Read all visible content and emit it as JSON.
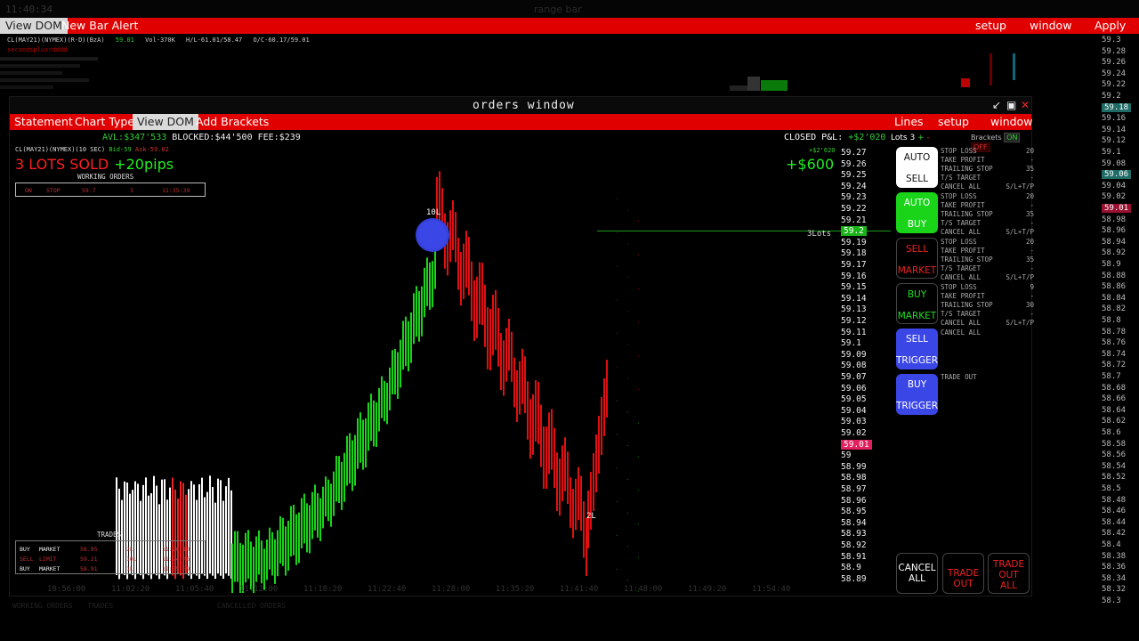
{
  "os_title": "range bar",
  "os_clock": "11:40:34",
  "topbar": {
    "view_dom": "View DOM",
    "new_bar_alert": "New Bar Alert",
    "setup": "setup",
    "window": "window",
    "apply": "Apply"
  },
  "bg_info": {
    "symbol": "CL(MAY21)(NYMEX)(R-D)(BzA)",
    "last": "59.01",
    "vol": "Vol-370K",
    "hl": "H/L-61.01/58.47",
    "oc": "O/C-60.17/59.01",
    "note": "secondsplusrdddd"
  },
  "far_ladder": [
    "59.3",
    "59.28",
    "59.26",
    "59.24",
    "59.22",
    "59.2",
    "59.18",
    "59.16",
    "59.14",
    "59.12",
    "59.1",
    "59.08",
    "59.06",
    "59.04",
    "59.02",
    "59.01",
    "58.98",
    "58.96",
    "58.94",
    "58.92",
    "58.9",
    "58.88",
    "58.86",
    "58.84",
    "58.82",
    "58.8",
    "58.78",
    "58.76",
    "58.74",
    "58.72",
    "58.7",
    "58.68",
    "58.66",
    "58.64",
    "58.62",
    "58.6",
    "58.58",
    "58.56",
    "58.54",
    "58.52",
    "58.5",
    "58.48",
    "58.46",
    "58.44",
    "58.42",
    "58.4",
    "58.38",
    "58.36",
    "58.34",
    "58.32",
    "58.3"
  ],
  "window": {
    "title": "orders window",
    "menu": {
      "statement": "Statement",
      "chart_type": "Chart Type",
      "view_dom": "View DOM",
      "add_brackets": "Add Brackets",
      "lines": "Lines",
      "setup": "setup",
      "window": "window"
    },
    "account": {
      "avl": "AVL:$347'533",
      "blocked": "BLOCKED:$44'500",
      "fee": "FEE:$239"
    },
    "closed_pnl_label": "CLOSED P&L:",
    "closed_pnl_value": "+$2'020",
    "lots_label": "Lots 3",
    "brackets_label": "Brackets",
    "brackets_on": "ON",
    "brackets_off": "OFF",
    "symbol_line": "CL(MAY21)(NYMEX)(10 SEC)",
    "bid": "Bid-59",
    "ask": "Ask-59.02",
    "status": "3 LOTS SOLD",
    "pips": "+20pips",
    "open_pnl": "+$600",
    "open_pnl_small": "+$2'620",
    "working_orders_label": "WORKING ORDERS",
    "working_order": {
      "side": "ON",
      "type": "STOP",
      "price": "59.7",
      "qty": "3",
      "time": "11:35:39"
    },
    "lot_tag": "3Lots",
    "trades_label": "TRADES",
    "trades": [
      {
        "side": "BUY",
        "type": "MARKET",
        "price": "58.95",
        "qty": "2L",
        "time": "11:20:10"
      },
      {
        "side": "SELL",
        "type": "LIMIT",
        "price": "59.21",
        "qty": "10L",
        "time": "11:24:46"
      },
      {
        "side": "BUY",
        "type": "MARKET",
        "price": "58.91",
        "qty": "1L",
        "time": "11:35:39"
      }
    ],
    "x_axis": [
      "10:56:00",
      "11:02:20",
      "11:05:40",
      "11:12:00",
      "11:18:20",
      "11:22:40",
      "11:28:00",
      "11:35:20",
      "11:41:40",
      "11:48:00",
      "11:49:20",
      "11:54:40"
    ],
    "ladder": [
      "59.27",
      "59.26",
      "59.25",
      "59.24",
      "59.23",
      "59.22",
      "59.21",
      "59.2",
      "59.19",
      "59.18",
      "59.17",
      "59.16",
      "59.15",
      "59.14",
      "59.13",
      "59.12",
      "59.11",
      "59.1",
      "59.09",
      "59.08",
      "59.07",
      "59.06",
      "59.05",
      "59.04",
      "59.03",
      "59.02",
      "59.01",
      "59",
      "58.99",
      "58.98",
      "58.97",
      "58.96",
      "58.95",
      "58.94",
      "58.93",
      "58.92",
      "58.91",
      "58.9",
      "58.89"
    ],
    "buttons": {
      "auto_sell": [
        "AUTO",
        "SELL"
      ],
      "auto_buy": [
        "AUTO",
        "BUY"
      ],
      "sell_market": [
        "SELL",
        "MARKET"
      ],
      "buy_market": [
        "BUY",
        "MARKET"
      ],
      "sell_trigger": [
        "SELL",
        "TRIGGER"
      ],
      "buy_trigger": [
        "BUY",
        "TRIGGER"
      ],
      "cancel_all": [
        "CANCEL",
        "ALL"
      ],
      "trade_out": [
        "TRADE",
        "OUT"
      ],
      "trade_out_all": [
        "TRADE",
        "OUT",
        "ALL"
      ]
    },
    "bracket_blocks": [
      {
        "stop_loss": "20",
        "take_profit": "-",
        "trailing_stop": "35",
        "ts_target": "-",
        "cancel": "CANCEL ALL",
        "slt": "S/L+T/P"
      },
      {
        "stop_loss": "20",
        "take_profit": "-",
        "trailing_stop": "35",
        "ts_target": "-",
        "cancel": "CANCEL ALL",
        "slt": "S/L+T/P"
      },
      {
        "stop_loss": "20",
        "take_profit": "-",
        "trailing_stop": "35",
        "ts_target": "-",
        "cancel": "CANCEL ALL",
        "slt": "S/L+T/P"
      },
      {
        "stop_loss": "9",
        "take_profit": "-",
        "trailing_stop": "30",
        "ts_target": "-",
        "cancel": "CANCEL ALL",
        "slt": "S/L+T/P"
      }
    ],
    "labels": {
      "stop_loss": "STOP LOSS",
      "take_profit": "TAKE PROFIT",
      "trailing_stop": "TRAILING STOP",
      "ts_target": "T/S TARGET",
      "cancel_all": "CANCEL ALL",
      "trade_out": "TRADE OUT"
    },
    "fill_marker_top": "10L",
    "fill_marker_bottom": "2L"
  },
  "bottom_tabs": [
    "WORKING ORDERS",
    "TRADES",
    "CANCELLED ORDERS"
  ],
  "colors": {
    "red": "#e00000",
    "green": "#1ad41a",
    "blue": "#3b46e6",
    "magenta": "#e0205f"
  }
}
